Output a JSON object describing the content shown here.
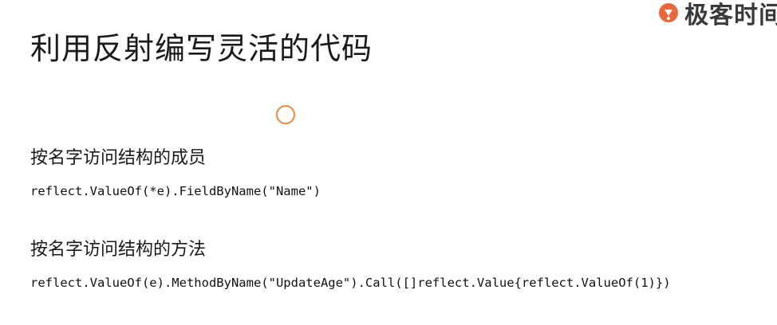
{
  "brand": {
    "name": "极客时间",
    "accent_color": "#e8683a",
    "icon": "geek-time-logo-icon"
  },
  "slide": {
    "title": "利用反射编写灵活的代码"
  },
  "pointer": {
    "icon": "circle-pointer-icon",
    "color": "#e8883a"
  },
  "sections": [
    {
      "heading": "按名字访问结构的成员",
      "code": "reflect.ValueOf(*e).FieldByName(\"Name\")"
    },
    {
      "heading": "按名字访问结构的方法",
      "code": "reflect.ValueOf(e).MethodByName(\"UpdateAge\").Call([]reflect.Value{reflect.ValueOf(1)})"
    }
  ]
}
